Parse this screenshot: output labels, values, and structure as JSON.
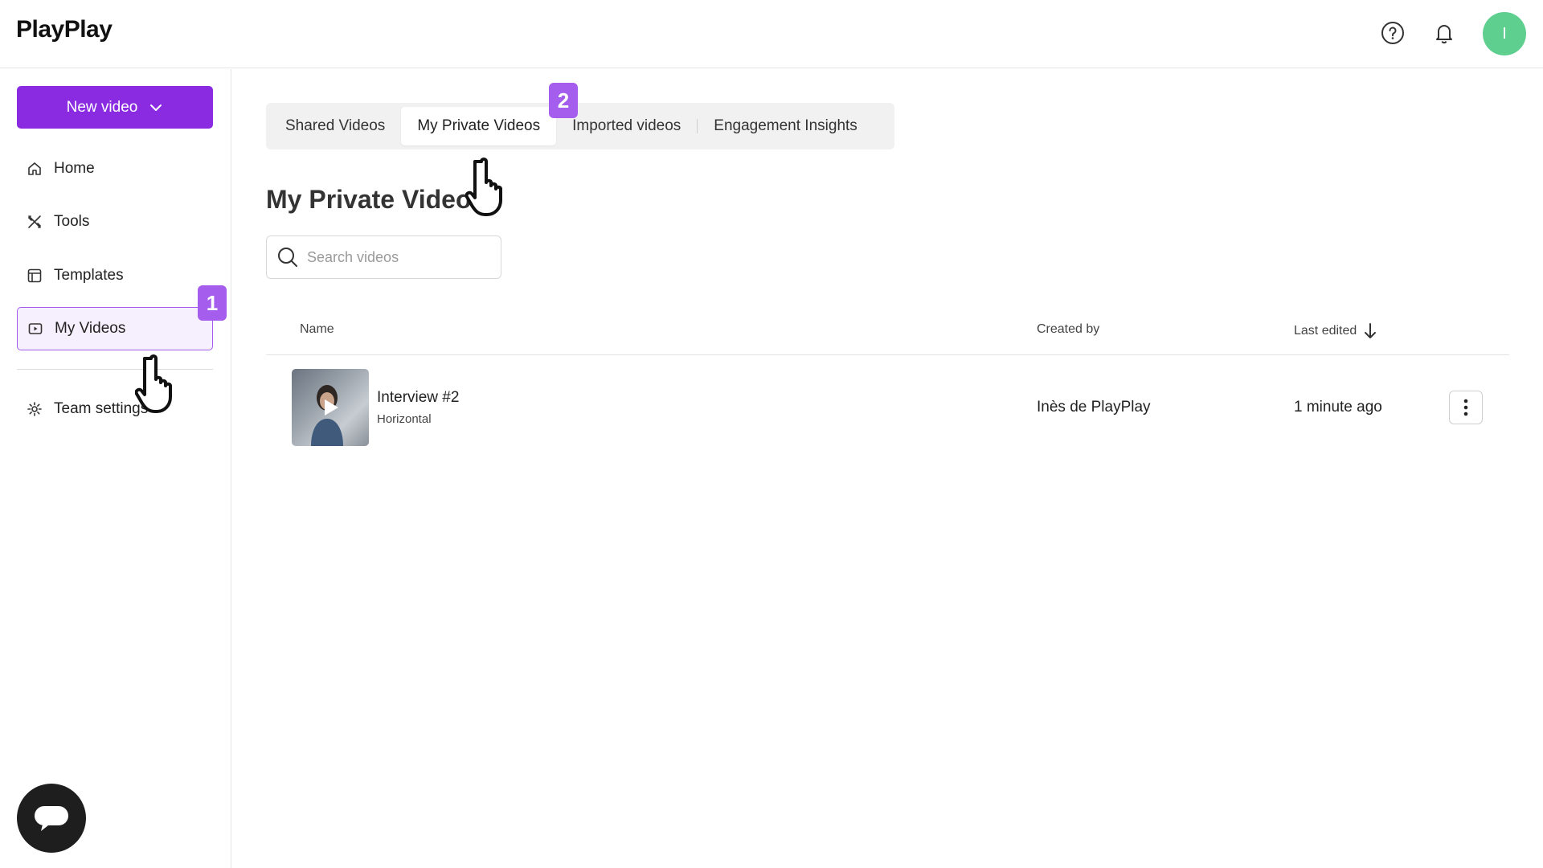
{
  "app": {
    "logo": "PlayPlay",
    "avatar_initial": "I",
    "accent": "#8a2be2",
    "avatar_color": "#5fcf8f"
  },
  "header": {
    "icons": [
      "help-icon",
      "bell-icon"
    ]
  },
  "sidebar": {
    "new_video_label": "New video",
    "items": [
      {
        "label": "Home",
        "icon": "home-icon"
      },
      {
        "label": "Tools",
        "icon": "tools-icon"
      },
      {
        "label": "Templates",
        "icon": "templates-icon"
      },
      {
        "label": "My Videos",
        "icon": "videos-icon",
        "active": true
      },
      {
        "label": "Team settings",
        "icon": "gear-icon"
      }
    ]
  },
  "annotations": {
    "step1": "1",
    "step2": "2"
  },
  "tabs": [
    {
      "label": "Shared Videos"
    },
    {
      "label": "My Private Videos",
      "active": true
    },
    {
      "label": "Imported videos"
    },
    {
      "label": "Engagement Insights"
    }
  ],
  "main": {
    "title": "My Private Videos",
    "search_placeholder": "Search videos"
  },
  "table": {
    "columns": {
      "name": "Name",
      "created_by": "Created by",
      "last_edited": "Last edited"
    },
    "rows": [
      {
        "title": "Interview #2",
        "format": "Horizontal",
        "creator": "Inès de PlayPlay",
        "edited": "1 minute ago"
      }
    ]
  }
}
